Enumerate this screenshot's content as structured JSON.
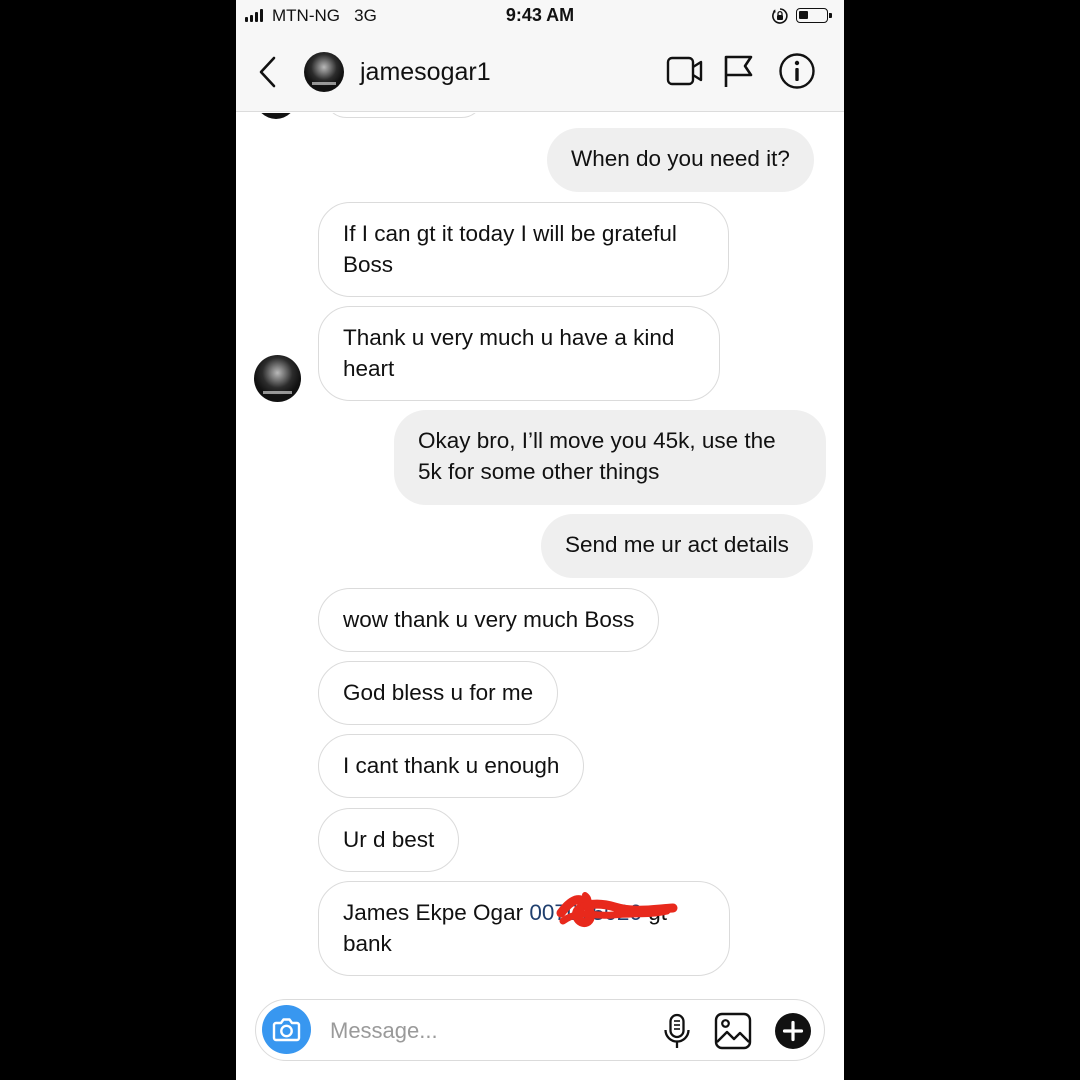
{
  "status_bar": {
    "carrier": "MTN-NG",
    "network": "3G",
    "time": "9:43 AM"
  },
  "header": {
    "username": "jamesogar1"
  },
  "messages": [
    {
      "direction": "outgoing",
      "text": "When do you need it?"
    },
    {
      "direction": "incoming",
      "text": "If I can gt it today I will be grateful\nBoss"
    },
    {
      "direction": "incoming",
      "text": "Thank u very much u have a kind\nheart"
    },
    {
      "direction": "outgoing",
      "text": "Okay bro, I’ll move you 45k, use the\n5k for some other things"
    },
    {
      "direction": "outgoing",
      "text": "Send me ur act details"
    },
    {
      "direction": "incoming",
      "text": "wow thank u very much Boss"
    },
    {
      "direction": "incoming",
      "text": "God bless u for me"
    },
    {
      "direction": "incoming",
      "text": "I cant thank u enough"
    },
    {
      "direction": "incoming",
      "text": "Ur d best"
    },
    {
      "direction": "incoming",
      "text_before": "James Ekpe Ogar ",
      "account_visible": "00",
      "account_obscured": "7075020",
      "text_after": " gt\nbank",
      "redacted": true
    }
  ],
  "composer": {
    "placeholder": "Message..."
  },
  "colors": {
    "accent": "#3897f0",
    "outgoing_bubble": "#efefef",
    "incoming_border": "#dbdbdb",
    "redaction": "#e8291c"
  },
  "icons": [
    "chevron-left-icon",
    "video-camera-icon",
    "flag-icon",
    "info-icon",
    "camera-icon",
    "microphone-icon",
    "gallery-icon",
    "plus-icon",
    "lock-rotation-icon",
    "battery-icon",
    "signal-icon"
  ]
}
